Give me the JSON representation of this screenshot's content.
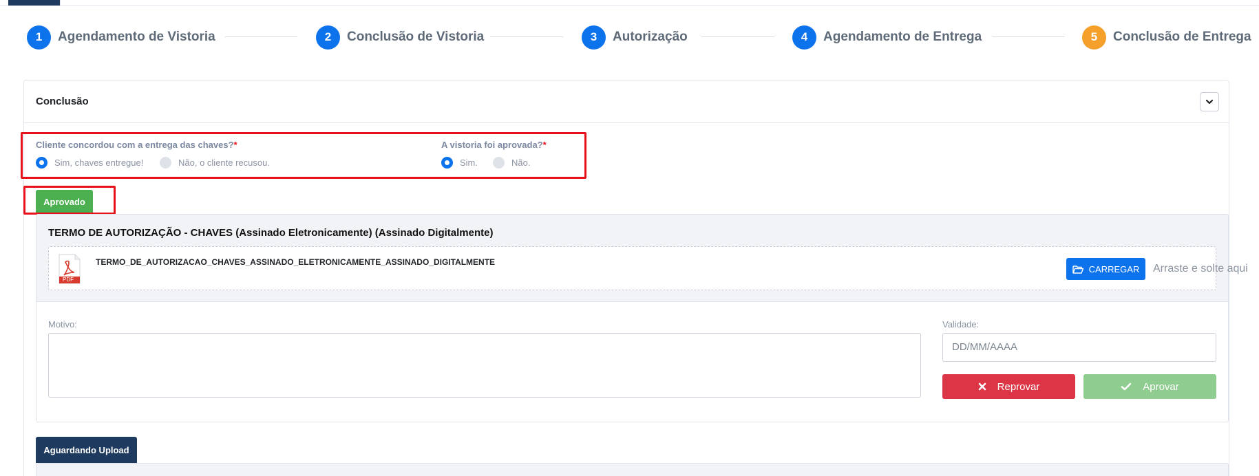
{
  "stepper": {
    "steps": [
      {
        "number": "1",
        "label": "Agendamento de Vistoria"
      },
      {
        "number": "2",
        "label": "Conclusão de Vistoria"
      },
      {
        "number": "3",
        "label": "Autorização"
      },
      {
        "number": "4",
        "label": "Agendamento de Entrega"
      },
      {
        "number": "5",
        "label": "Conclusão de Entrega"
      }
    ],
    "colors": {
      "done": "#0d73ec",
      "current": "#f4a02b"
    }
  },
  "card": {
    "title": "Conclusão",
    "collapse_icon": "chevron-down-icon"
  },
  "questions": {
    "keys": {
      "label": "Cliente concordou com a entrega das chaves?",
      "required_mark": "*",
      "options": [
        {
          "label": "Sim, chaves entregue!",
          "selected": true
        },
        {
          "label": "Não, o cliente recusou.",
          "selected": false
        }
      ]
    },
    "inspection": {
      "label": "A vistoria foi aprovada?",
      "required_mark": "*",
      "options": [
        {
          "label": "Sim.",
          "selected": true
        },
        {
          "label": "Não.",
          "selected": false
        }
      ]
    }
  },
  "status_badge": {
    "label": "Aprovado",
    "color": "#4caf50"
  },
  "document": {
    "title": "TERMO DE AUTORIZAÇÃO - CHAVES (Assinado Eletronicamente) (Assinado Digitalmente)",
    "file_icon": "pdf-file-icon",
    "file_icon_text": "PDF",
    "file_name": "TERMO_DE_AUTORIZACAO_CHAVES_ASSINADO_ELETRONICAMENTE_ASSINADO_DIGITALMENTE",
    "upload_label": "CARREGAR",
    "upload_icon": "folder-open-icon",
    "drop_hint": "Arraste e solte aqui"
  },
  "review": {
    "reason_label": "Motivo:",
    "reason_value": "",
    "validity_label": "Validade:",
    "validity_placeholder": "DD/MM/AAAA",
    "reject_label": "Reprovar",
    "reject_icon": "x-icon",
    "approve_label": "Aprovar",
    "approve_icon": "check-icon",
    "colors": {
      "reject": "#dc3545",
      "approve": "#8fcc8f"
    }
  },
  "second_badge": {
    "label": "Aguardando Upload",
    "color": "#1f3a5f"
  }
}
